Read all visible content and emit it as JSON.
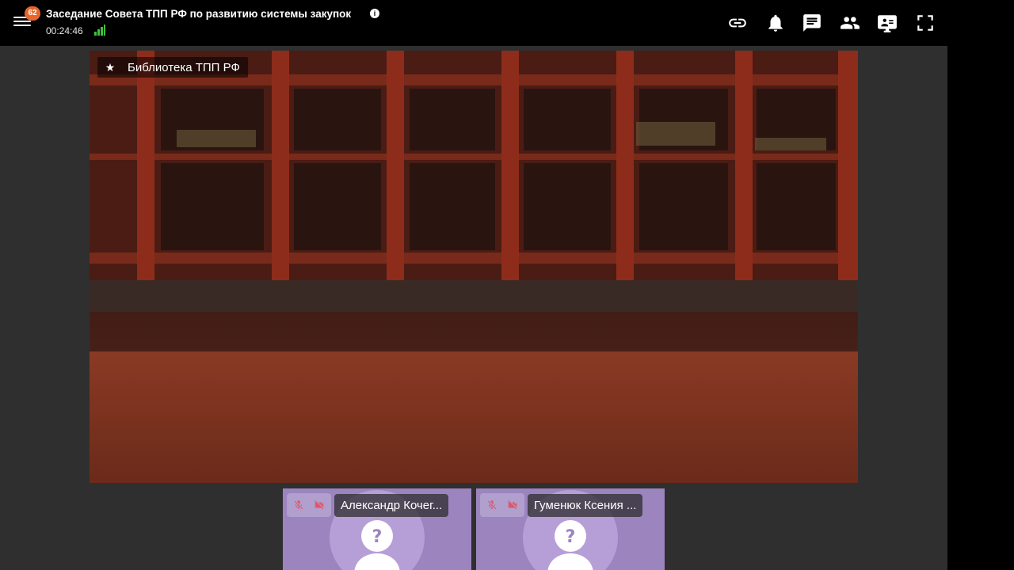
{
  "header": {
    "badge_count": "62",
    "title": "Заседание Совета ТПП РФ по развитию системы закупок",
    "timer": "00:24:46"
  },
  "video": {
    "pin_label": "Библиотека ТПП РФ"
  },
  "participants": [
    {
      "name": "Александр Кочег..."
    },
    {
      "name": "Гуменюк Ксения ..."
    }
  ],
  "colors": {
    "accent_badge": "#e8662b",
    "signal": "#3fbf3f",
    "tile_bg": "#9c84bf",
    "stage_bg": "#2f2f2f"
  },
  "icons": {
    "menu": "menu-icon",
    "info": "info-icon",
    "signal": "signal-bars-icon",
    "link": "link-icon",
    "bell": "bell-icon",
    "chat": "chat-icon",
    "people": "participants-icon",
    "screen": "present-icon",
    "fullscreen": "fullscreen-icon"
  }
}
